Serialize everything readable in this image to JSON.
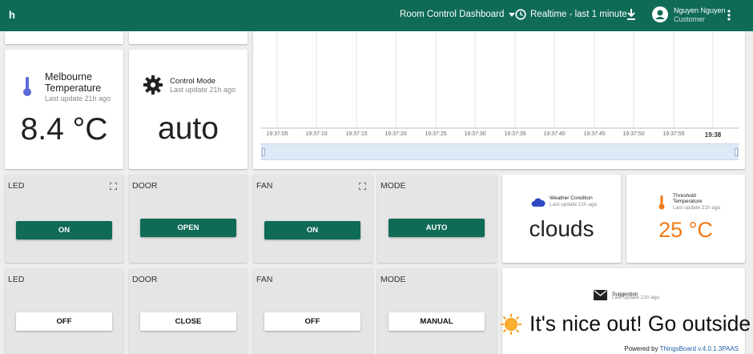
{
  "header": {
    "logo": "h",
    "dashboard": "Room Control Dashboard",
    "timewindow": "Realtime - last 1 minute",
    "user_name": "Nguyen Nguyen",
    "user_role": "Customer"
  },
  "temperature": {
    "title": "Melbourne Temperature",
    "subtitle": "Last update 21h ago",
    "value": "8.4 °C"
  },
  "control_mode": {
    "title": "Control Mode",
    "subtitle": "Last update 21h ago",
    "value": "auto"
  },
  "chart_data": {
    "type": "line",
    "x_ticks": [
      "19:37:05",
      "19:37:10",
      "19:37:15",
      "19:37:20",
      "19:37:25",
      "19:37:30",
      "19:37:35",
      "19:37:40",
      "19:37:45",
      "19:37:50",
      "19:37:55",
      "19:38"
    ],
    "series": [],
    "grid": true
  },
  "controls_row1": [
    {
      "label": "LED",
      "button": "ON"
    },
    {
      "label": "DOOR",
      "button": "OPEN"
    },
    {
      "label": "FAN",
      "button": "ON"
    },
    {
      "label": "MODE",
      "button": "AUTO"
    }
  ],
  "controls_row2": [
    {
      "label": "LED",
      "button": "OFF"
    },
    {
      "label": "DOOR",
      "button": "CLOSE"
    },
    {
      "label": "FAN",
      "button": "OFF"
    },
    {
      "label": "MODE",
      "button": "MANUAL"
    }
  ],
  "weather": {
    "title": "Weather Condition",
    "subtitle": "Last update 21h ago",
    "value": "clouds"
  },
  "threshold": {
    "title": "Threshold Temperature",
    "subtitle": "Last update 21h ago",
    "value": "25 °C",
    "color": "#f07a16"
  },
  "suggestion": {
    "title": "Suggestion",
    "subtitle": "Last update 21h ago",
    "value": "It's nice out! Go outside"
  },
  "footer": {
    "powered_by": "Powered by",
    "link": "ThingsBoard v.4.0.1.3PAAS"
  }
}
